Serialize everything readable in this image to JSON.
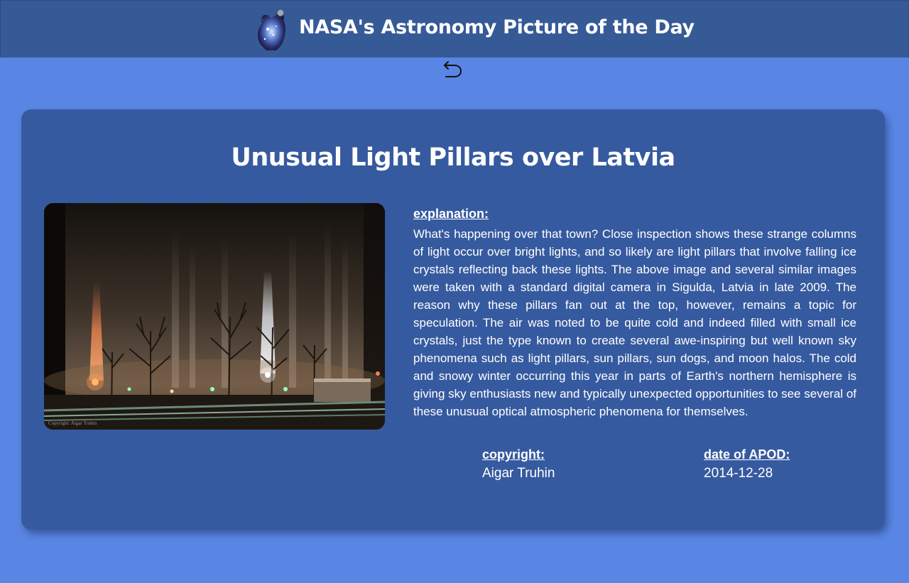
{
  "header": {
    "title": "NASA's Astronomy Picture of the Day",
    "logo_icon": "astronaut-galaxy-logo-icon"
  },
  "nav": {
    "back_icon": "undo-arrow-icon"
  },
  "apod": {
    "title": "Unusual Light Pillars over Latvia",
    "image_watermark": "Copyright: Aigar Truhin",
    "explanation_label": "explanation:",
    "explanation": "What's happening over that town? Close inspection shows these strange columns of light occur over bright lights, and so likely are light pillars that involve falling ice crystals reflecting back these lights. The above image and several similar images were taken with a standard digital camera in Sigulda, Latvia in late 2009. The reason why these pillars fan out at the top, however, remains a topic for speculation. The air was noted to be quite cold and indeed filled with small ice crystals, just the type known to create several awe-inspiring but well known sky phenomena such as light pillars, sun pillars, sun dogs, and moon halos. The cold and snowy winter occurring this year in parts of Earth's northern hemisphere is giving sky enthusiasts new and typically unexpected opportunities to see several of these unusual optical atmospheric phenomena for themselves.",
    "copyright_label": "copyright:",
    "copyright": "Aigar Truhin",
    "date_label": "date of APOD:",
    "date": "2014-12-28"
  },
  "colors": {
    "page_background": "#5986e4",
    "header_background": "#365a96",
    "card_background": "#365a9f",
    "text": "#ffffff"
  }
}
